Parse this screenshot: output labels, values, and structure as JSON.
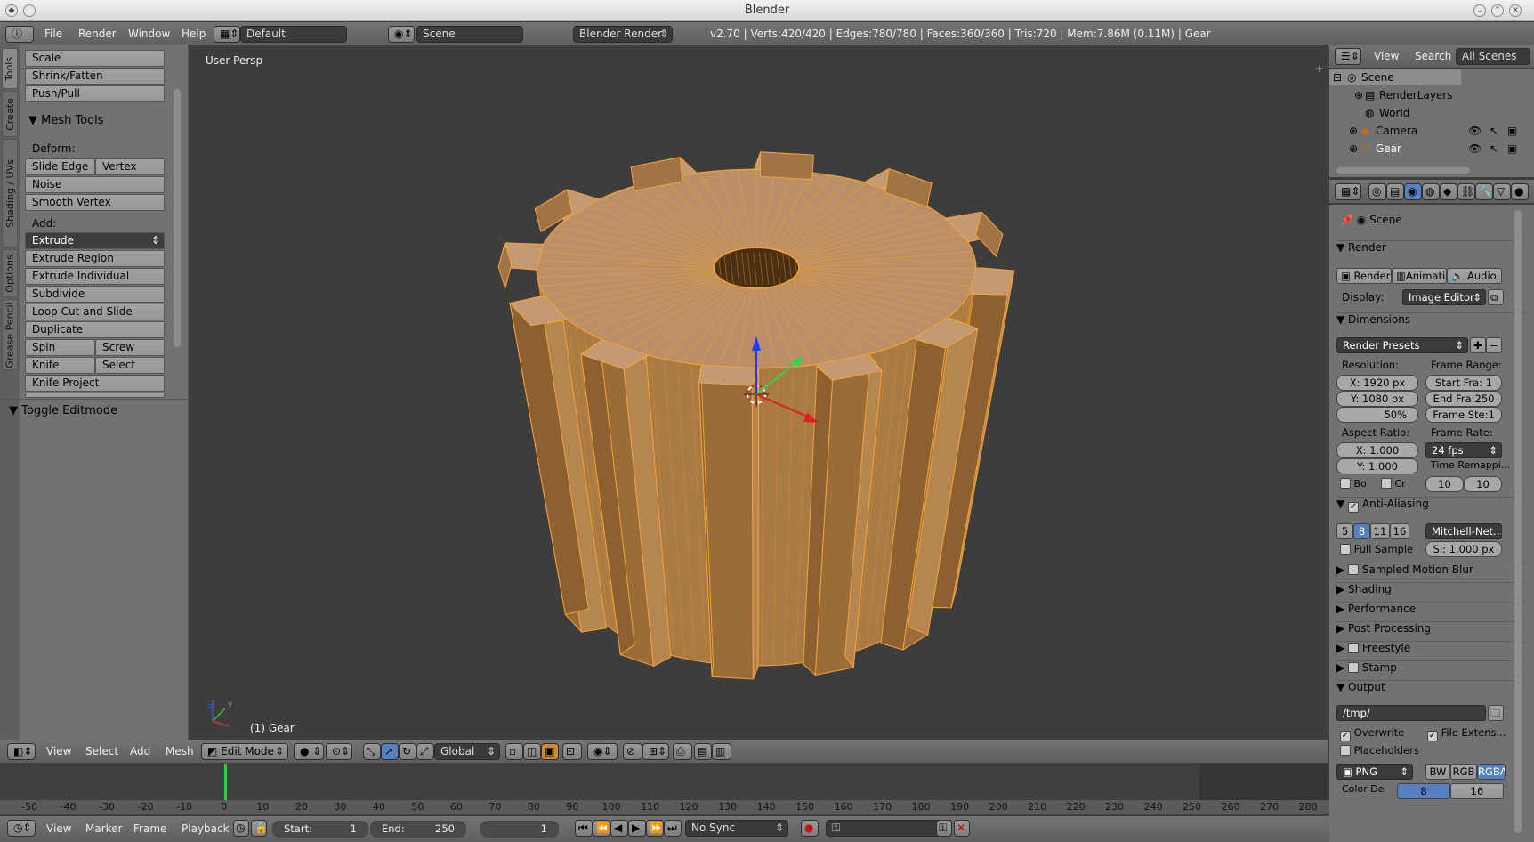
{
  "window": {
    "title": "Blender"
  },
  "info_header": {
    "menus": [
      "File",
      "Render",
      "Window",
      "Help"
    ],
    "layout": "Default",
    "scene": "Scene",
    "engine": "Blender Render",
    "stats": "v2.70 | Verts:420/420 | Edges:780/780 | Faces:360/360 | Tris:720 | Mem:7.86M (0.11M) | Gear"
  },
  "tool_tabs": [
    "Tools",
    "Create",
    "Shading / UVs",
    "Options",
    "Grease Pencil"
  ],
  "toolshelf": {
    "top_buttons": [
      "Scale",
      "Shrink/Fatten",
      "Push/Pull"
    ],
    "mesh_tools": {
      "title": "Mesh Tools",
      "deform_label": "Deform:",
      "slide_edge": "Slide Edge",
      "vertex": "Vertex",
      "noise": "Noise",
      "smooth_vertex": "Smooth Vertex",
      "add_label": "Add:",
      "extrude": "Extrude",
      "extrude_region": "Extrude Region",
      "extrude_individual": "Extrude Individual",
      "subdivide": "Subdivide",
      "loop_cut": "Loop Cut and Slide",
      "duplicate": "Duplicate",
      "spin": "Spin",
      "screw": "Screw",
      "knife": "Knife",
      "select": "Select",
      "knife_project": "Knife Project"
    },
    "toggle_editmode": "Toggle Editmode"
  },
  "viewport": {
    "view_label": "User Persp",
    "object_label": "(1) Gear"
  },
  "view3d_header": {
    "menus": [
      "View",
      "Select",
      "Add",
      "Mesh"
    ],
    "mode": "Edit Mode",
    "orientation": "Global"
  },
  "outliner": {
    "header": {
      "view": "View",
      "search": "Search",
      "filter": "All Scenes"
    },
    "items": [
      "Scene",
      "RenderLayers",
      "World",
      "Camera",
      "Gear"
    ]
  },
  "properties": {
    "context": "Scene",
    "render_panel": "Render",
    "render_tabs": [
      "Render",
      "Animatio",
      "Audio"
    ],
    "display_label": "Display:",
    "display_value": "Image Editor",
    "dimensions_panel": "Dimensions",
    "render_presets": "Render Presets",
    "resolution_label": "Resolution:",
    "res_x": "X:",
    "res_x_val": "1920 px",
    "res_y": "Y:",
    "res_y_val": "1080 px",
    "res_pct": "50%",
    "frame_range_label": "Frame Range:",
    "start_frame": "Start Fra:",
    "start_frame_val": "1",
    "end_frame": "End Fra:",
    "end_frame_val": "250",
    "frame_step": "Frame Ste:",
    "frame_step_val": "1",
    "aspect_label": "Aspect Ratio:",
    "aspect_x": "X:",
    "aspect_x_val": "1.000",
    "aspect_y": "Y:",
    "aspect_y_val": "1.000",
    "frame_rate_label": "Frame Rate:",
    "frame_rate": "24 fps",
    "time_remap": "Time Remappi...",
    "remap_old": "10",
    "remap_new": "10",
    "border": "Bo",
    "crop": "Cr",
    "aa_panel": "Anti-Aliasing",
    "aa_samples": [
      "5",
      "8",
      "11",
      "16"
    ],
    "aa_active": "8",
    "aa_filter": "Mitchell-Net...",
    "full_sample": "Full Sample",
    "filter_size": "Si: 1.000 px",
    "collapsed": [
      "Sampled Motion Blur",
      "Shading",
      "Performance",
      "Post Processing",
      "Freestyle",
      "Stamp"
    ],
    "output_panel": "Output",
    "output_path": "/tmp/",
    "overwrite": "Overwrite",
    "file_ext": "File Extens...",
    "placeholders": "Placeholders",
    "format": "PNG",
    "color_modes": [
      "BW",
      "RGB",
      "RGBA"
    ],
    "color_depth_label": "Color De",
    "color_depths": [
      "8",
      "16"
    ]
  },
  "timeline": {
    "ticks": [
      "-50",
      "-40",
      "-30",
      "-20",
      "-10",
      "0",
      "10",
      "20",
      "30",
      "40",
      "50",
      "60",
      "70",
      "80",
      "90",
      "100",
      "110",
      "120",
      "130",
      "140",
      "150",
      "160",
      "170",
      "180",
      "190",
      "200",
      "210",
      "220",
      "230",
      "240",
      "250",
      "260",
      "270",
      "280"
    ],
    "current_frame": 1
  },
  "timeline_header": {
    "menus": [
      "View",
      "Marker",
      "Frame",
      "Playback"
    ],
    "start": "Start:",
    "start_val": "1",
    "end": "End:",
    "end_val": "250",
    "current": "1",
    "sync": "No Sync"
  }
}
